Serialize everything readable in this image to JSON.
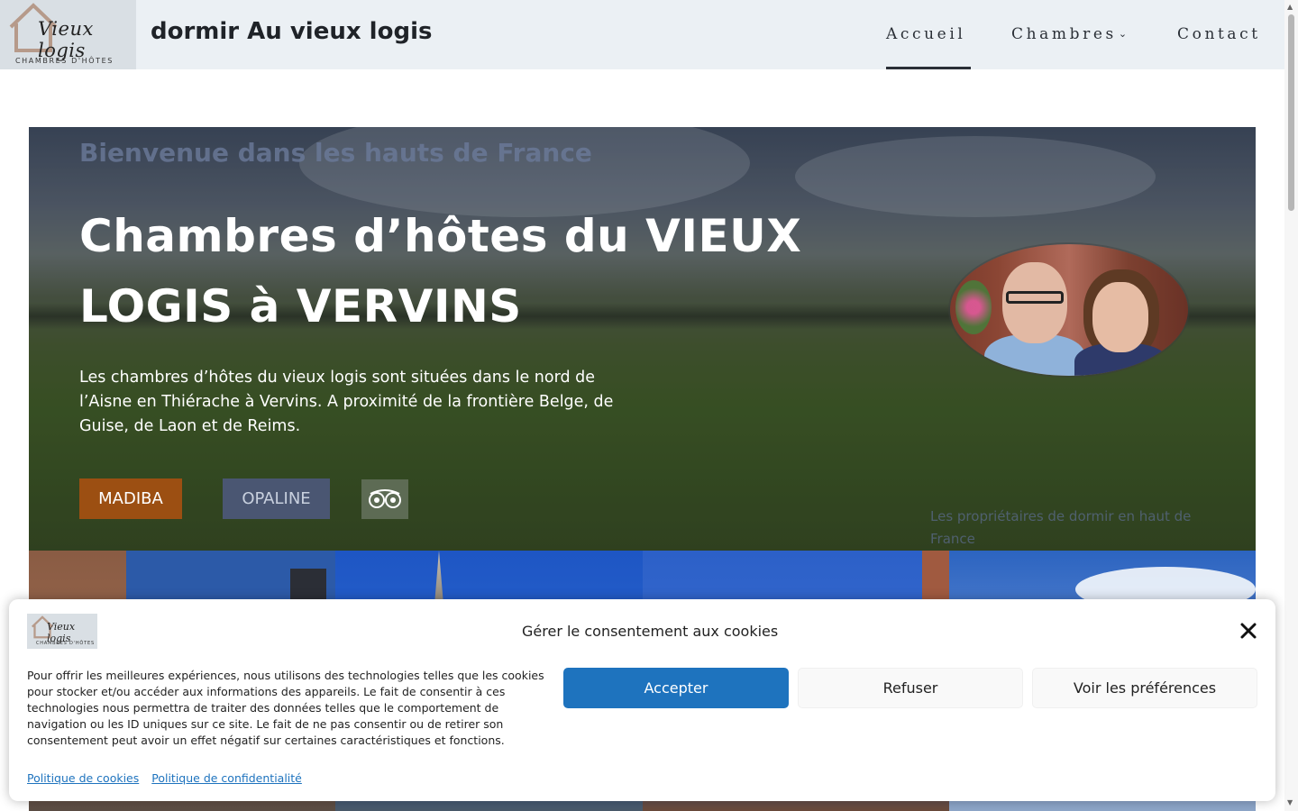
{
  "header": {
    "logo_script": "Vieux logis",
    "logo_subtitle": "CHAMBRES D'HÔTES",
    "site_title": "dormir Au vieux logis",
    "nav": {
      "accueil": "Accueil",
      "chambres": "Chambres",
      "contact": "Contact"
    }
  },
  "hero": {
    "welcome": "Bienvenue dans les hauts de France",
    "title": "Chambres d’hôtes du VIEUX LOGIS à VERVINS",
    "text": "Les chambres d’hôtes du vieux logis sont situées dans le nord de l’Aisne en Thiérache à Vervins. A proximité de la frontière Belge, de Guise, de Laon et de Reims.",
    "buttons": {
      "madiba": "MADIBA",
      "opaline": "OPALINE"
    },
    "owners_caption": "Les propriétaires de dormir en haut de France"
  },
  "cookie_banner": {
    "logo_script": "Vieux logis",
    "logo_subtitle": "CHAMBRES D'HÔTES",
    "title": "Gérer le consentement aux cookies",
    "text": "Pour offrir les meilleures expériences, nous utilisons des technologies telles que les cookies pour stocker et/ou accéder aux informations des appareils. Le fait de consentir à ces technologies nous permettra de traiter des données telles que le comportement de navigation ou les ID uniques sur ce site. Le fait de ne pas consentir ou de retirer son consentement peut avoir un effet négatif sur certaines caractéristiques et fonctions.",
    "accept": "Accepter",
    "refuse": "Refuser",
    "preferences": "Voir les préférences",
    "cookie_policy": "Politique de cookies",
    "privacy_policy": "Politique de confidentialité"
  },
  "colors": {
    "header_bg": "#ebf0f4",
    "madiba_button": "#9c4f12",
    "opaline_button": "#4a5672",
    "accept_button": "#1e73be"
  },
  "icons": {
    "tripadvisor": "tripadvisor-icon",
    "close": "close-icon",
    "chevron": "chevron-down-icon",
    "house": "house-icon"
  }
}
